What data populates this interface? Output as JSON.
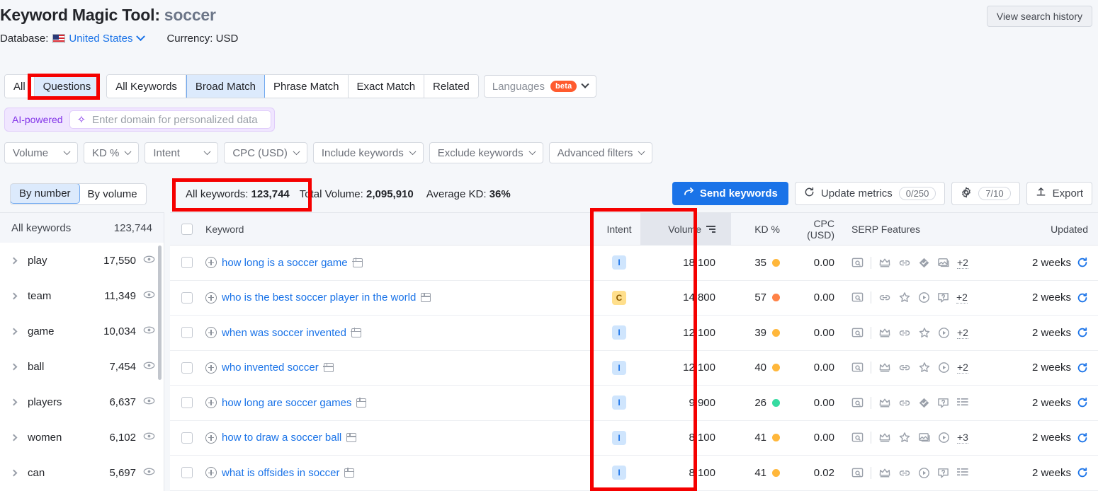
{
  "header": {
    "title": "Keyword Magic Tool:",
    "query": "soccer",
    "database_label": "Database:",
    "database_value": "United States",
    "currency": "Currency: USD",
    "view_search_history": "View search history"
  },
  "tabs": {
    "group1": [
      {
        "label": "All",
        "selected": false
      },
      {
        "label": "Questions",
        "selected": true
      }
    ],
    "group2": [
      {
        "label": "All Keywords",
        "selected": false
      },
      {
        "label": "Broad Match",
        "selected": true
      },
      {
        "label": "Phrase Match",
        "selected": false
      },
      {
        "label": "Exact Match",
        "selected": false
      },
      {
        "label": "Related",
        "selected": false
      }
    ],
    "languages": {
      "label": "Languages",
      "badge": "beta"
    }
  },
  "ai_bar": {
    "label": "AI-powered",
    "placeholder": "Enter domain for personalized data",
    "value": ""
  },
  "filters": [
    {
      "label": "Volume"
    },
    {
      "label": "KD %"
    },
    {
      "label": "Intent"
    },
    {
      "label": "CPC (USD)"
    },
    {
      "label": "Include keywords"
    },
    {
      "label": "Exclude keywords"
    },
    {
      "label": "Advanced filters"
    }
  ],
  "group_toggle": [
    {
      "label": "By number",
      "selected": true
    },
    {
      "label": "By volume",
      "selected": false
    }
  ],
  "stats": {
    "all_keywords_label": "All keywords:",
    "all_keywords_value": "123,744",
    "total_volume_label": "Total Volume:",
    "total_volume_value": "2,095,910",
    "average_kd_label": "Average KD:",
    "average_kd_value": "36%"
  },
  "actions": {
    "send_keywords": "Send keywords",
    "update_metrics": "Update metrics",
    "update_metrics_count": "0/250",
    "settings_count": "7/10",
    "export": "Export"
  },
  "sidebar": {
    "header": {
      "label": "All keywords",
      "count": "123,744"
    },
    "items": [
      {
        "label": "play",
        "count": "17,550"
      },
      {
        "label": "team",
        "count": "11,349"
      },
      {
        "label": "game",
        "count": "10,034"
      },
      {
        "label": "ball",
        "count": "7,454"
      },
      {
        "label": "players",
        "count": "6,637"
      },
      {
        "label": "women",
        "count": "6,102"
      },
      {
        "label": "can",
        "count": "5,697"
      }
    ]
  },
  "table": {
    "columns": {
      "keyword": "Keyword",
      "intent": "Intent",
      "volume": "Volume",
      "kd": "KD %",
      "cpc": "CPC (USD)",
      "serp": "SERP Features",
      "updated": "Updated"
    },
    "rows": [
      {
        "keyword": "how long is a soccer game",
        "intent": "I",
        "intent_color": "#cfe5fd",
        "intent_text": "#1a73e8",
        "volume": "18,100",
        "kd": "35",
        "kd_color": "#ffb73b",
        "cpc": "0.00",
        "serp": [
          "serp-preview-icon",
          "crown-icon",
          "link-icon",
          "diamond-icon",
          "image-icon"
        ],
        "serp_more": "+2",
        "updated": "2 weeks"
      },
      {
        "keyword": "who is the best soccer player in the world",
        "intent": "C",
        "intent_color": "#ffdf8c",
        "intent_text": "#8a5a00",
        "volume": "14,800",
        "kd": "57",
        "kd_color": "#ff8247",
        "cpc": "0.00",
        "serp": [
          "serp-preview-icon",
          "link-icon",
          "star-icon",
          "video-icon",
          "faq-icon"
        ],
        "serp_more": "+2",
        "updated": "2 weeks"
      },
      {
        "keyword": "when was soccer invented",
        "intent": "I",
        "intent_color": "#cfe5fd",
        "intent_text": "#1a73e8",
        "volume": "12,100",
        "kd": "39",
        "kd_color": "#ffb73b",
        "cpc": "0.00",
        "serp": [
          "serp-preview-icon",
          "crown-icon",
          "link-icon",
          "star-icon",
          "video-icon"
        ],
        "serp_more": "+2",
        "updated": "2 weeks"
      },
      {
        "keyword": "who invented soccer",
        "intent": "I",
        "intent_color": "#cfe5fd",
        "intent_text": "#1a73e8",
        "volume": "12,100",
        "kd": "40",
        "kd_color": "#ffb73b",
        "cpc": "0.00",
        "serp": [
          "serp-preview-icon",
          "crown-icon",
          "link-icon",
          "star-icon",
          "video-icon"
        ],
        "serp_more": "+2",
        "updated": "2 weeks"
      },
      {
        "keyword": "how long are soccer games",
        "intent": "I",
        "intent_color": "#cfe5fd",
        "intent_text": "#1a73e8",
        "volume": "9,900",
        "kd": "26",
        "kd_color": "#36dba1",
        "cpc": "0.00",
        "serp": [
          "serp-preview-icon",
          "crown-icon",
          "link-icon",
          "diamond-icon",
          "faq-icon",
          "list-icon"
        ],
        "serp_more": "",
        "updated": "2 weeks"
      },
      {
        "keyword": "how to draw a soccer ball",
        "intent": "I",
        "intent_color": "#cfe5fd",
        "intent_text": "#1a73e8",
        "volume": "8,100",
        "kd": "41",
        "kd_color": "#ffb73b",
        "cpc": "0.00",
        "serp": [
          "serp-preview-icon",
          "crown-icon",
          "star-icon",
          "image-icon",
          "video-icon"
        ],
        "serp_more": "+3",
        "updated": "2 weeks"
      },
      {
        "keyword": "what is offsides in soccer",
        "intent": "I",
        "intent_color": "#cfe5fd",
        "intent_text": "#1a73e8",
        "volume": "8,100",
        "kd": "41",
        "kd_color": "#ffb73b",
        "cpc": "0.02",
        "serp": [
          "serp-preview-icon",
          "crown-icon",
          "link-icon",
          "video-icon",
          "faq-icon",
          "list-icon"
        ],
        "serp_more": "",
        "updated": "2 weeks"
      }
    ]
  },
  "annotations": {
    "color": "#f50000",
    "boxes": [
      "questions-tab",
      "all-keywords-stat",
      "volume-column"
    ]
  }
}
